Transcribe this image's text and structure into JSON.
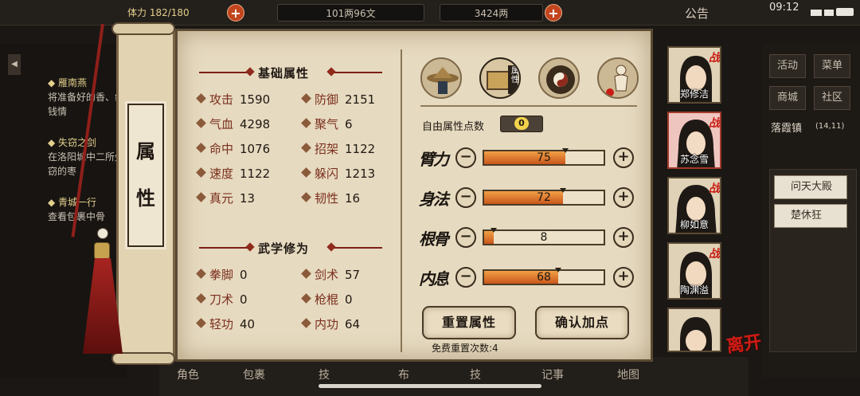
{
  "topbar": {
    "stamina_label": "体力",
    "stamina_value": "182/180",
    "money": "101两96文",
    "gold": "3424两",
    "notice": "公告",
    "time": "09:12"
  },
  "quests": [
    {
      "title": "雁南燕",
      "desc": "将准备好的香、纸钱情"
    },
    {
      "title": "失窃之剑",
      "desc": "在洛阳城中二所失窃的枣"
    },
    {
      "title": "青城一行",
      "desc": "查看包裹中骨"
    }
  ],
  "right_panel": {
    "buttons": [
      "活动",
      "菜单",
      "商城",
      "社区"
    ],
    "town": "落霞镇",
    "coords": "(14,11)",
    "items": [
      "问天大殿",
      "楚休狂"
    ]
  },
  "bottom_tabs": [
    "角色",
    "包裹",
    "技",
    "布",
    "技",
    "记事",
    "地图"
  ],
  "scroll": {
    "label_1": "属",
    "label_2": "性"
  },
  "basic": {
    "title": "基础属性",
    "stats": [
      {
        "label": "攻击",
        "value": "1590"
      },
      {
        "label": "防御",
        "value": "2151"
      },
      {
        "label": "气血",
        "value": "4298"
      },
      {
        "label": "聚气",
        "value": "6"
      },
      {
        "label": "命中",
        "value": "1076"
      },
      {
        "label": "招架",
        "value": "1122"
      },
      {
        "label": "速度",
        "value": "1122"
      },
      {
        "label": "躲闪",
        "value": "1213"
      },
      {
        "label": "真元",
        "value": "13"
      },
      {
        "label": "韧性",
        "value": "16"
      }
    ]
  },
  "martial": {
    "title": "武学修为",
    "stats": [
      {
        "label": "拳脚",
        "value": "0"
      },
      {
        "label": "剑术",
        "value": "57"
      },
      {
        "label": "刀术",
        "value": "0"
      },
      {
        "label": "枪棍",
        "value": "0"
      },
      {
        "label": "轻功",
        "value": "40"
      },
      {
        "label": "内功",
        "value": "64"
      }
    ]
  },
  "tabs": {
    "attr_tab_label": "属性"
  },
  "free_points": {
    "label": "自由属性点数",
    "value": "0"
  },
  "attributes": [
    {
      "name": "臂力",
      "value": "75",
      "fill": 0.68
    },
    {
      "name": "身法",
      "value": "72",
      "fill": 0.66
    },
    {
      "name": "根骨",
      "value": "8",
      "fill": 0.08
    },
    {
      "name": "内息",
      "value": "68",
      "fill": 0.62
    }
  ],
  "buttons": {
    "reset": "重置属性",
    "confirm": "确认加点",
    "free_reset": "免费重置次数:4"
  },
  "characters": [
    {
      "name": "郑修洁",
      "tag": "战"
    },
    {
      "name": "苏念雪",
      "tag": "战"
    },
    {
      "name": "柳如意",
      "tag": "战"
    },
    {
      "name": "陶渊溢",
      "tag": "战"
    },
    {
      "name": "",
      "tag": ""
    }
  ],
  "leave_label": "离开",
  "colors": {
    "accent_red": "#c81c14",
    "bar_orange": "#e27f2c",
    "parchment": "#e6dac0"
  }
}
